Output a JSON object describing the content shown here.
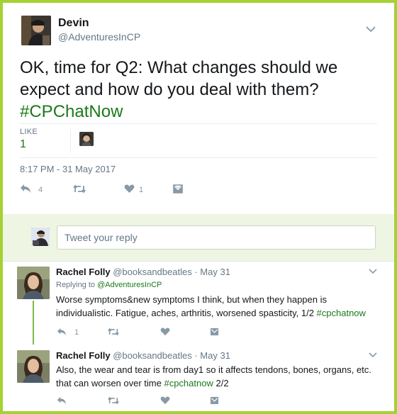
{
  "main_tweet": {
    "author_name": "Devin",
    "author_handle": "@AdventuresInCP",
    "text_before": "OK, time for Q2: What changes should we expect and how do you deal with them? ",
    "hashtag": "#CPChatNow",
    "likes_label": "LIKE",
    "likes_count": "1",
    "timestamp": "8:17 PM - 31 May 2017",
    "reply_count": "4",
    "like_count_action": "1"
  },
  "reply_box": {
    "placeholder": "Tweet your reply"
  },
  "replies": [
    {
      "author_name": "Rachel Folly",
      "author_handle": "@booksandbeatles",
      "sep": "·",
      "date": "May 31",
      "replying_to_label": "Replying to ",
      "replying_to_handle": "@AdventuresInCP",
      "text": "Worse symptoms&new symptoms I think, but when they happen is individualistic. Fatigue, aches, arthritis, worsened spasticity, 1/2 ",
      "hashtag": "#cpchatnow",
      "reply_count": "1"
    },
    {
      "author_name": "Rachel Folly",
      "author_handle": "@booksandbeatles",
      "sep": "·",
      "date": "May 31",
      "text": "Also, the wear and tear is from day1 so it affects tendons, bones, organs, etc. that can worsen over time ",
      "hashtag": "#cpchatnow",
      "text_after": " 2/2"
    }
  ],
  "colors": {
    "frame": "#a4d233",
    "hashtag": "#1a7a1a",
    "reply_bg": "#eef6e3"
  }
}
